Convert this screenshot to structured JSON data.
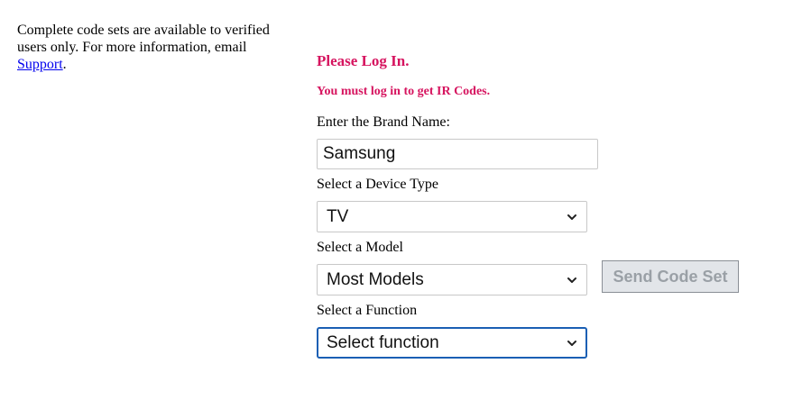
{
  "info": {
    "text": "Complete code sets are available to verified users only. For more information, email ",
    "link_label": "Support",
    "trailing": "."
  },
  "login": {
    "heading": "Please Log In.",
    "note": "You must log in to get IR Codes."
  },
  "form": {
    "brand_label": "Enter the Brand Name:",
    "brand_value": "Samsung",
    "device_label": "Select a Device Type",
    "device_value": "TV",
    "model_label": "Select a Model",
    "model_value": "Most Models",
    "function_label": "Select a Function",
    "function_value": "Select function",
    "send_button": "Send Code Set"
  },
  "colors": {
    "accent": "#d6145f",
    "link": "#0000ee",
    "focus": "#1a5fb4"
  },
  "icons": {
    "dropdown": "chevron-down-icon"
  }
}
